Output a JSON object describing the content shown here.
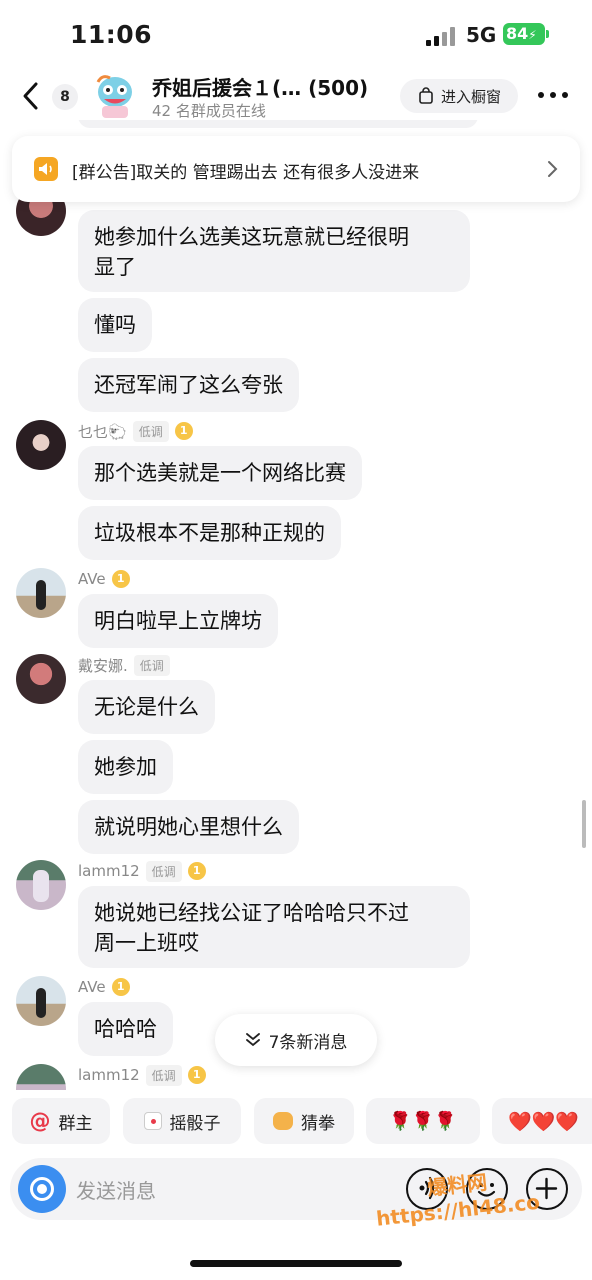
{
  "status_bar": {
    "time": "11:06",
    "network": "5G",
    "battery": "84"
  },
  "header": {
    "unread_count": "8",
    "group_name": "乔姐后援会１(… (500)",
    "online_text": "42 名群成员在线",
    "window_button": "进入橱窗"
  },
  "announcement": {
    "text": "[群公告]取关的 管理踢出去 还有很多人没进来"
  },
  "messages": [
    {
      "bubbles": [
        "她参加什么选美这玩意就已经很明",
        "显了",
        "懂吗",
        "还冠军闹了这么夸张"
      ]
    },
    {
      "sender": "乜乜🐑",
      "tag": "低调",
      "level": "1",
      "bubbles": [
        "那个选美就是一个网络比赛",
        "垃圾根本不是那种正规的"
      ]
    },
    {
      "sender": "AVe",
      "level": "1",
      "bubbles": [
        "明白啦早上立牌坊"
      ]
    },
    {
      "sender": "戴安娜.",
      "tag": "低调",
      "bubbles": [
        "无论是什么",
        "她参加",
        "就说明她心里想什么"
      ]
    },
    {
      "sender": "lamm12",
      "tag": "低调",
      "level": "1",
      "bubbles": [
        "她说她已经找公证了哈哈哈只不过",
        "周一上班哎"
      ]
    },
    {
      "sender": "AVe",
      "level": "1",
      "bubbles": [
        "哈哈哈"
      ]
    },
    {
      "sender": "lamm12",
      "tag": "低调",
      "level": "1"
    }
  ],
  "new_messages": "7条新消息",
  "quick_actions": [
    "群主",
    "摇骰子",
    "猜拳",
    "🌹🌹🌹",
    "❤️❤️❤️"
  ],
  "input": {
    "placeholder": "发送消息"
  },
  "watermark": {
    "line1": "爆料网",
    "line2": "https://hl48.co"
  },
  "colors": {
    "accent_blue": "#3b8ef0",
    "battery_green": "#34c759",
    "bubble_gray": "#f2f2f4",
    "level_gold": "#f7c547",
    "mention_red": "#e83a4a"
  }
}
